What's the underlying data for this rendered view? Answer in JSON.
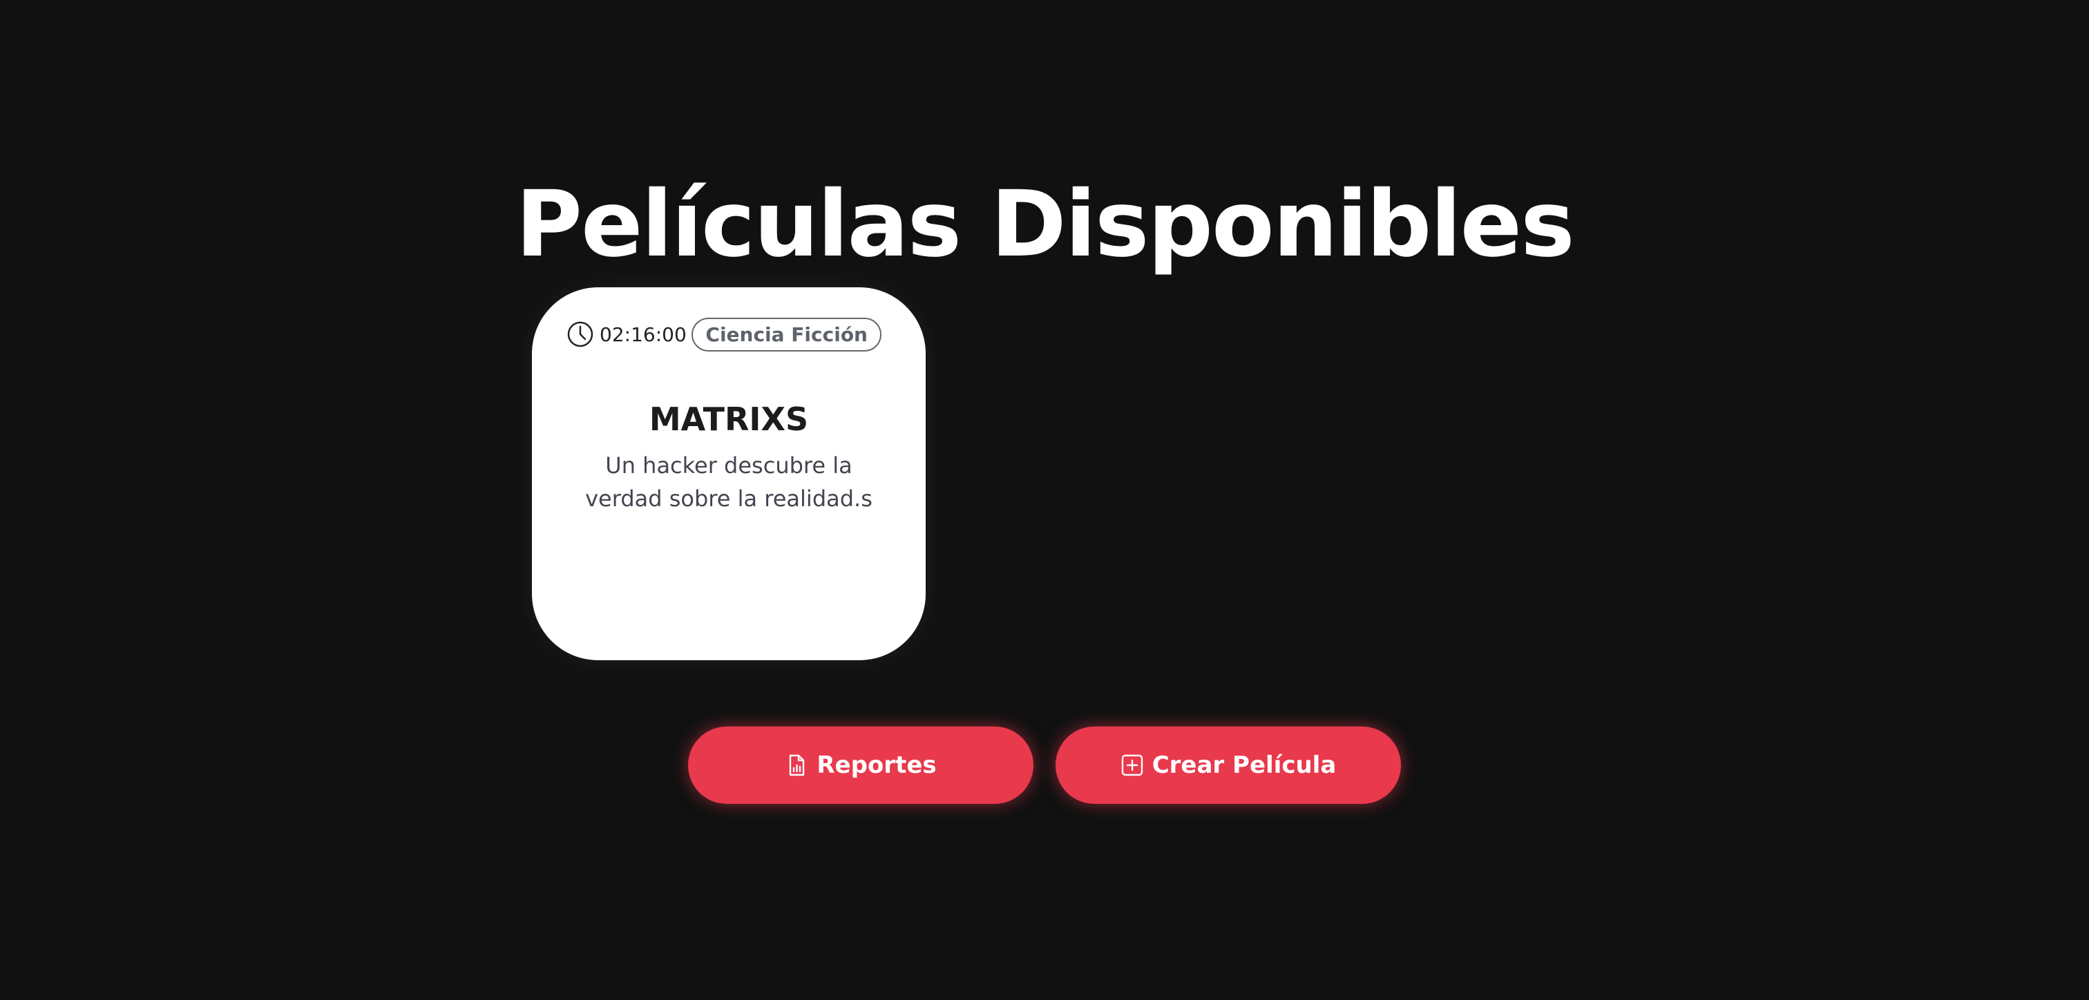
{
  "page": {
    "title": "Películas Disponibles"
  },
  "movies": [
    {
      "duration": "02:16:00",
      "genre": "Ciencia Ficción",
      "title": "MATRIXS",
      "description": "Un hacker descubre la verdad sobre la realidad.s"
    }
  ],
  "actions": {
    "reports_label": "Reportes",
    "create_label": "Crear Película"
  },
  "icons": {
    "duration": "clock-icon",
    "reports": "file-chart-icon",
    "create": "plus-square-icon"
  },
  "colors": {
    "background": "#111111",
    "card": "#ffffff",
    "accent": "#e8394d"
  }
}
